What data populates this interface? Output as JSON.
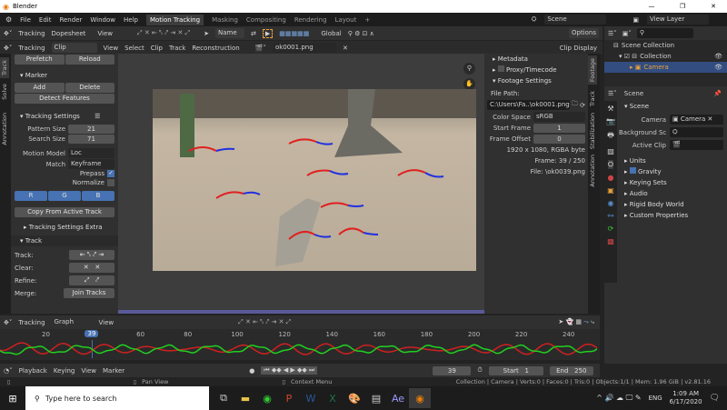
{
  "window": {
    "title": "Blender",
    "minimize": "—",
    "maximize": "❐",
    "close": "✕"
  },
  "menu": [
    "File",
    "Edit",
    "Render",
    "Window",
    "Help"
  ],
  "workspaces": [
    "Motion Tracking",
    "Masking",
    "Compositing",
    "Rendering",
    "Layout"
  ],
  "scene": "Scene",
  "view_layer": "View Layer",
  "dopesheet_header": {
    "mode": "Tracking",
    "view_type": "Dopesheet",
    "view": "View",
    "sort": "Name",
    "orientation": "Global",
    "options": "Options"
  },
  "clip_header": {
    "mode": "Tracking",
    "view_type": "Clip",
    "menus": [
      "View",
      "Select",
      "Clip",
      "Track",
      "Reconstruction"
    ],
    "clip_name": "ok0001.png",
    "clip_display": "Clip Display"
  },
  "left_panel": {
    "tabs": [
      "Track",
      "Solve",
      "Annotation"
    ],
    "prefetch": "Prefetch",
    "reload": "Reload",
    "marker": {
      "title": "Marker",
      "add": "Add",
      "delete": "Delete",
      "detect": "Detect Features"
    },
    "tracking_settings": {
      "title": "Tracking Settings",
      "pattern_size_label": "Pattern Size",
      "pattern_size": "21",
      "search_size_label": "Search Size",
      "search_size": "71",
      "motion_model_label": "Motion Model",
      "motion_model": "Loc",
      "match_label": "Match",
      "match": "Keyframe",
      "prepass": "Prepass",
      "prepass_checked": true,
      "normalize": "Normalize",
      "normalize_checked": false,
      "channels": [
        "R",
        "G",
        "B"
      ],
      "copy": "Copy From Active Track",
      "extra": "Tracking Settings Extra"
    },
    "track": {
      "title": "Track",
      "track_label": "Track:",
      "clear_label": "Clear:",
      "refine_label": "Refine:",
      "merge_label": "Merge:",
      "join": "Join Tracks"
    }
  },
  "footage_panel": {
    "tabs": [
      "Footage",
      "Track",
      "Stabilization",
      "Annotation"
    ],
    "metadata": "Metadata",
    "proxy": "Proxy/Timecode",
    "settings": "Footage Settings",
    "file_path_label": "File Path:",
    "file_path": "C:\\Users\\Fa..\\ok0001.png",
    "color_space_label": "Color Space",
    "color_space": "sRGB",
    "start_frame_label": "Start Frame",
    "start_frame": "1",
    "frame_offset_label": "Frame Offset",
    "frame_offset": "0",
    "resolution": "1920 x 1080, RGBA byte",
    "frame": "Frame: 39 / 250",
    "file": "File: \\ok0039.png"
  },
  "outliner": {
    "root": "Scene Collection",
    "collection": "Collection",
    "camera": "Camera"
  },
  "properties": {
    "context": "Scene",
    "section": "Scene",
    "camera_label": "Camera",
    "camera": "Camera",
    "background_label": "Background Sce..",
    "active_clip_label": "Active Clip",
    "panels": [
      "Units",
      "Gravity",
      "Keying Sets",
      "Audio",
      "Rigid Body World",
      "Custom Properties"
    ],
    "gravity_checked": true
  },
  "graph_header": {
    "mode": "Tracking",
    "view_type": "Graph",
    "view": "View"
  },
  "graph": {
    "ticks": [
      "20",
      "40",
      "60",
      "80",
      "100",
      "120",
      "140",
      "160",
      "180",
      "200",
      "220",
      "240"
    ],
    "current_frame": "39"
  },
  "timeline": {
    "menus": [
      "Playback",
      "Keying",
      "View",
      "Marker"
    ],
    "current": "39",
    "start_label": "Start",
    "start": "1",
    "end_label": "End",
    "end": "250"
  },
  "status_bar": {
    "pan": "Pan View",
    "context": "Context Menu",
    "stats": "Collection | Camera | Verts:0 | Faces:0 | Tris:0 | Objects:1/1 | Mem: 1.96 GiB | v2.81.16"
  },
  "taskbar": {
    "search_placeholder": "Type here to search",
    "time": "1:09 AM",
    "date": "6/17/2020",
    "lang": "ENG"
  }
}
